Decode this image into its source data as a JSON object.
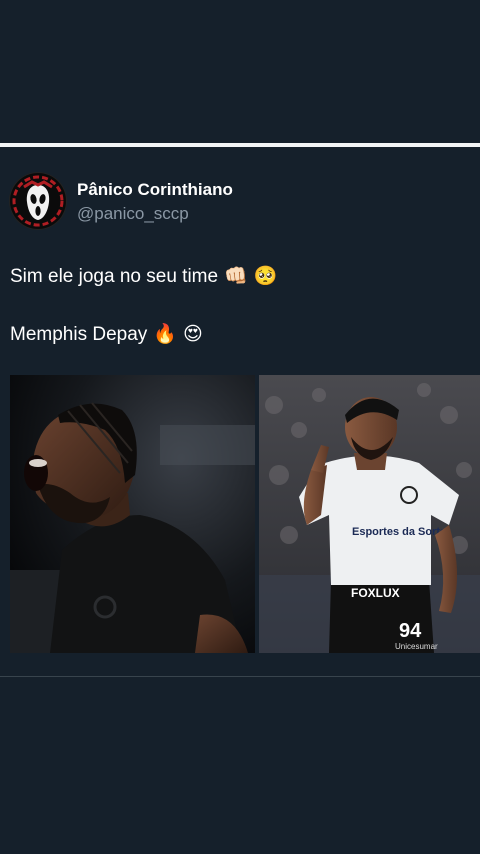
{
  "tweet": {
    "author_name": "Pânico Corinthiano",
    "author_handle": "@panico_sccp",
    "line1_text": "Sim ele joga no seu time",
    "line1_emojis": "👊🏻 🥺",
    "line2_text": "Memphis Depay",
    "line2_emojis": "🔥 😍"
  },
  "media": {
    "left_photo": "player-roar-photo",
    "right_photo": "player-celebration-photo",
    "right_photo_shirt_sponsor": "Esportes da Sorte",
    "right_photo_shorts_sponsor": "FOXLUX",
    "right_photo_number": "94",
    "right_photo_brand": "Unicesumar"
  },
  "colors": {
    "background": "#15202b",
    "secondary_text": "#8b98a5",
    "divider": "#38444d"
  }
}
